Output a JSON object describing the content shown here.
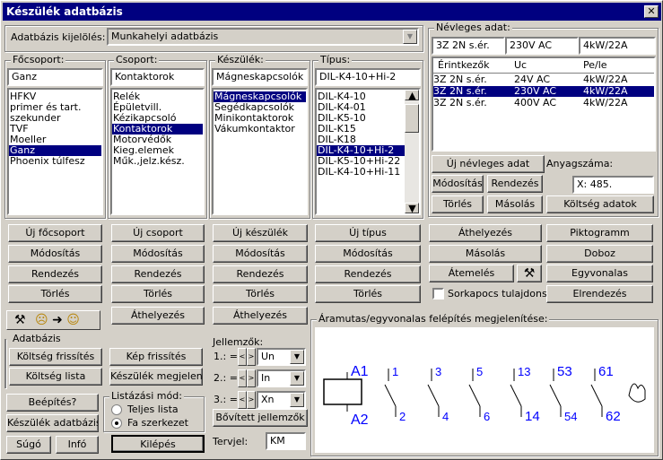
{
  "window": {
    "title": "Készülék adatbázis",
    "close": "✕"
  },
  "db": {
    "label": "Adatbázis kijelölés:",
    "value": "Munkahelyi adatbázis"
  },
  "focsoport": {
    "label": "Főcsoport:",
    "current": "Ganz",
    "items": [
      "HFKV",
      "primer és tart.",
      "szekunder",
      "TVF",
      "Moeller",
      "Ganz",
      "Phoenix túlfesz"
    ],
    "selected": 5
  },
  "csoport": {
    "label": "Csoport:",
    "current": "Kontaktorok",
    "items": [
      "Relék",
      "Épületvill.",
      "Kézikapcsoló",
      "Kontaktorok",
      "Motorvédők",
      "Kieg.elemek",
      "Műk.,jelz.kész."
    ],
    "selected": 3
  },
  "keszulek": {
    "label": "Készülék:",
    "current": "Mágneskapcsolók",
    "items": [
      "Mágneskapcsolók",
      "Segédkapcsolók",
      "Minikontaktorok",
      "Vákumkontaktor"
    ],
    "selected": 0
  },
  "tipus": {
    "label": "Típus:",
    "current": "DIL-K4-10+Hi-2",
    "items": [
      "DIL-K4-10",
      "DIL-K4-01",
      "DIL-K5-10",
      "DIL-K15",
      "DIL-K18",
      "DIL-K4-10+Hi-2",
      "DIL-K5-10+Hi-22",
      "DIL-K4-10+Hi-11"
    ],
    "selected": 5
  },
  "cols": {
    "focsoport": [
      "Új főcsoport",
      "Módosítás",
      "Rendezés",
      "Törlés"
    ],
    "csoport": [
      "Új csoport",
      "Módosítás",
      "Rendezés",
      "Törlés",
      "Áthelyezés"
    ],
    "keszulek": [
      "Új készülék",
      "Módosítás",
      "Rendezés",
      "Törlés",
      "Áthelyezés"
    ],
    "tipus": [
      "Új típus",
      "Módosítás",
      "Rendezés",
      "Törlés"
    ]
  },
  "nevleges": {
    "label": "Névleges adat:",
    "fields": [
      "3Z 2N s.ér.",
      "230V AC",
      "4kW/22A"
    ],
    "headers": [
      "Érintkezők",
      "Uc",
      "Pe/le"
    ],
    "rows": [
      [
        "3Z 2N s.ér.",
        "24V AC",
        "4kW/22A"
      ],
      [
        "3Z 2N s.ér.",
        "230V AC",
        "4kW/22A"
      ],
      [
        "3Z 2N s.ér.",
        "400V AC",
        "4kW/22A"
      ]
    ],
    "selected": 1,
    "uj": "Új névleges adat",
    "modositas": "Módosítás",
    "rendezes": "Rendezés",
    "torles": "Törlés",
    "masolas": "Másolás",
    "anyagszam_label": "Anyagszáma:",
    "anyagszam_value": "X:  485.",
    "koltseg": "Költség adatok"
  },
  "right_buttons": {
    "athelyezes": "Áthelyezés",
    "piktogramm": "Piktogramm",
    "masolas": "Másolás",
    "doboz": "Doboz",
    "atemeles": "Átemelés",
    "egyvonalas": "Egyvonalas",
    "sorkapocs": "Sorkapocs tulajdons.",
    "elrendezes": "Elrendezés"
  },
  "aramutas": {
    "label": "Áramutas/egyvonalas felépítés megjelenítése:",
    "coil_top": "A1",
    "coil_bottom": "A2",
    "top_nums": [
      "1",
      "3",
      "5",
      "13",
      "53",
      "61"
    ],
    "bottom_nums": [
      "2",
      "4",
      "6",
      "14",
      "54",
      "62"
    ]
  },
  "adatbazis": {
    "label": "Adatbázis",
    "koltseg_frissites": "Költség frissítés",
    "kep_frissites": "Kép frissítés",
    "koltseg_lista": "Költség lista",
    "keszulek_megjelenit": "Készülék megjelenít"
  },
  "jellemzok": {
    "label": "Jellemzők:",
    "rows": [
      {
        "num": "1.:",
        "eq": "=",
        "value": "Un"
      },
      {
        "num": "2.:",
        "eq": "=",
        "value": "In"
      },
      {
        "num": "3.:",
        "eq": "=",
        "value": "Xn"
      }
    ],
    "bovitett": "Bővített jellemzők",
    "tervjel_label": "Tervjel:",
    "tervjel_value": "KM"
  },
  "bottom": {
    "beepites": "Beépítés?",
    "keszulek_adatbazis": "Készülék adatbázis",
    "sugo": "Súgó",
    "info": "Infó",
    "kilepes": "Kilépés"
  },
  "listazasi": {
    "label": "Listázási mód:",
    "opt1": "Teljes lista",
    "opt2": "Fa szerkezet",
    "selected": 1
  }
}
